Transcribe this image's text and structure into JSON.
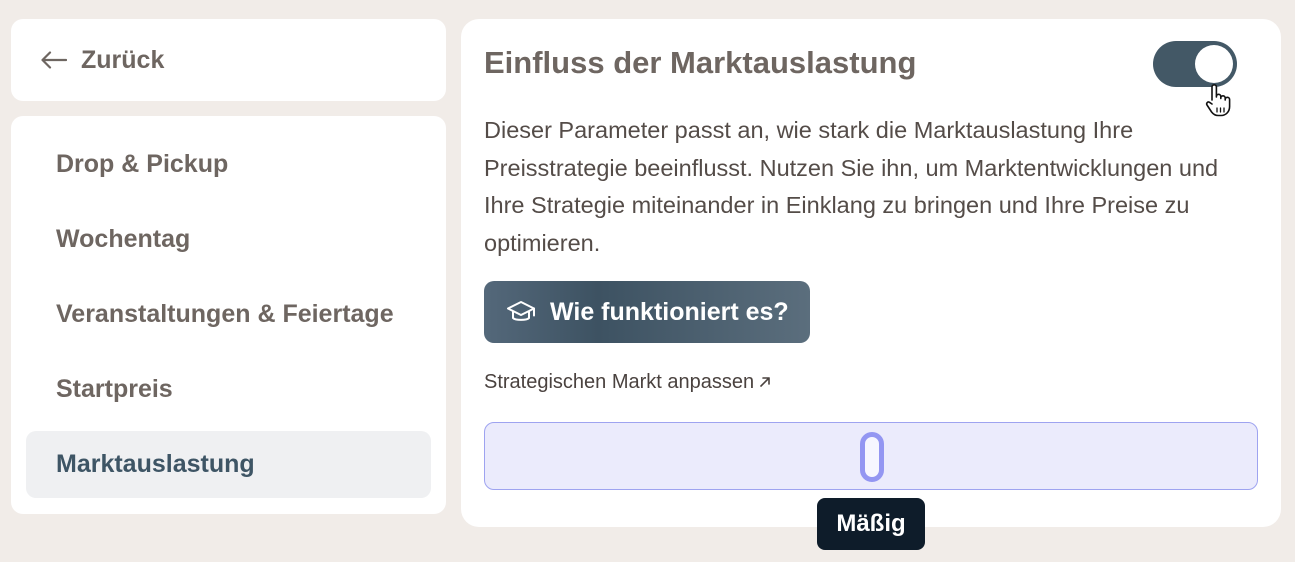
{
  "back": {
    "label": "Zurück",
    "icon": "arrow-left-icon"
  },
  "sidebar": {
    "items": [
      {
        "label": "Drop & Pickup",
        "active": false
      },
      {
        "label": "Wochentag",
        "active": false
      },
      {
        "label": "Veranstaltungen & Feiertage",
        "active": false
      },
      {
        "label": "Startpreis",
        "active": false
      },
      {
        "label": "Marktauslastung",
        "active": true
      }
    ]
  },
  "main": {
    "title": "Einfluss der Marktauslastung",
    "toggle_on": true,
    "description": "Dieser Parameter passt an, wie stark die Marktauslastung Ihre Preisstrategie beeinflusst. Nutzen Sie ihn, um Marktentwicklungen und Ihre Strategie miteinander in Einklang zu bringen und Ihre Preise zu optimieren.",
    "help_button": {
      "label": "Wie funktioniert es?",
      "icon": "graduation-cap-icon"
    },
    "link": {
      "label": "Strategischen Markt anpassen",
      "icon": "arrow-up-right-icon"
    },
    "slider": {
      "value_label": "Mäßig",
      "level": 0.5
    }
  },
  "colors": {
    "accent": "#435866",
    "slider_track": "#ebebfc",
    "slider_handle": "#9396f2",
    "tooltip_bg": "#0e1c2a"
  }
}
